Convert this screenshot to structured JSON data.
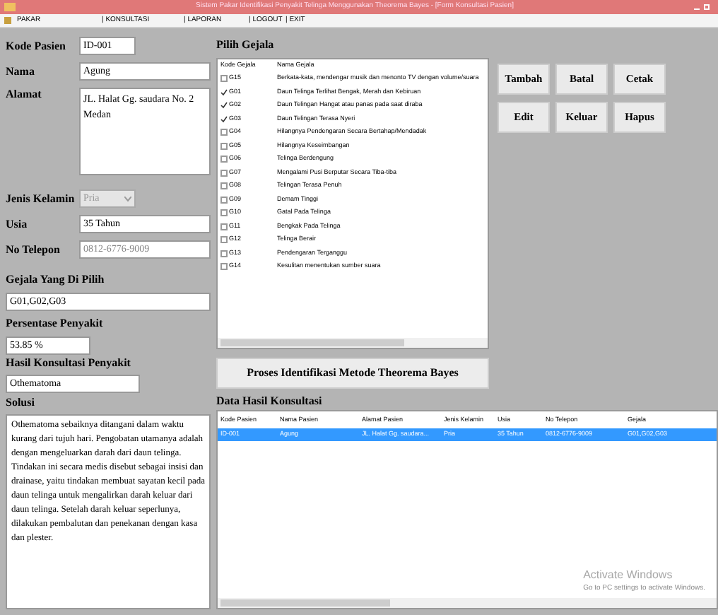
{
  "window": {
    "title": "Sistem Pakar Identifikasi Penyakit Telinga Menggunakan Theorema Bayes - [Form Konsultasi Pasien]"
  },
  "menu": [
    {
      "label": "PAKAR"
    },
    {
      "label": "| KONSULTASI"
    },
    {
      "label": "| LAPORAN"
    },
    {
      "label": "| LOGOUT"
    },
    {
      "label": "| EXIT"
    }
  ],
  "patient": {
    "fields": [
      {
        "label": "Kode Pasien",
        "value": "ID-001",
        "kind": "short"
      },
      {
        "label": "Nama",
        "value": "Agung",
        "kind": "text"
      },
      {
        "label": "Alamat",
        "value": "JL. Halat Gg. saudara No. 2 Medan",
        "kind": "area"
      },
      {
        "label": "Jenis Kelamin",
        "value": "Pria",
        "kind": "select"
      },
      {
        "label": "Usia",
        "value": "35 Tahun",
        "kind": "text"
      },
      {
        "label": "No Telepon",
        "value": "0812-6776-9009",
        "kind": "readonly"
      }
    ]
  },
  "selected_symptoms": {
    "label": "Gejala Yang Di Pilih",
    "value": "G01,G02,G03"
  },
  "percentage": {
    "label": "Persentase Penyakit",
    "value": "53.85 %"
  },
  "result": {
    "label": "Hasil Konsultasi Penyakit",
    "value": "Othematoma"
  },
  "solution": {
    "label": "Solusi",
    "text": "Othematoma sebaiknya ditangani dalam waktu kurang dari tujuh hari. Pengobatan utamanya adalah dengan mengeluarkan darah dari daun telinga. Tindakan ini secara medis disebut sebagai insisi dan drainase, yaitu tindakan membuat sayatan kecil pada daun telinga untuk mengalirkan darah keluar dari daun telinga. Setelah darah keluar seperlunya, dilakukan pembalutan dan penekanan dengan kasa dan plester."
  },
  "symptoms": {
    "title": "Pilih Gejala",
    "columns": [
      "Kode Gejala",
      "Nama Gejala"
    ],
    "rows": [
      {
        "code": "G15",
        "name": "Berkata-kata, mendengar musik dan menonto TV dengan volume/suara",
        "checked": false
      },
      {
        "code": "G01",
        "name": "Daun Telinga Terlihat Bengak, Merah dan Kebiruan",
        "checked": true
      },
      {
        "code": "G02",
        "name": "Daun Telingan Hangat atau panas pada saat diraba",
        "checked": true
      },
      {
        "code": "G03",
        "name": "Daun Telingan Terasa Nyeri",
        "checked": true
      },
      {
        "code": "G04",
        "name": "Hilangnya Pendengaran Secara Bertahap/Mendadak",
        "checked": false
      },
      {
        "code": "G05",
        "name": "Hilangnya Keseimbangan",
        "checked": false
      },
      {
        "code": "G06",
        "name": "Telinga Berdengung",
        "checked": false
      },
      {
        "code": "G07",
        "name": "Mengalami Pusi Berputar Secara Tiba-tiba",
        "checked": false
      },
      {
        "code": "G08",
        "name": "Telingan Terasa Penuh",
        "checked": false
      },
      {
        "code": "G09",
        "name": "Demam Tinggi",
        "checked": false
      },
      {
        "code": "G10",
        "name": "Gatal Pada Telinga",
        "checked": false
      },
      {
        "code": "G11",
        "name": "Bengkak Pada Telinga",
        "checked": false
      },
      {
        "code": "G12",
        "name": "Telinga Berair",
        "checked": false
      },
      {
        "code": "G13",
        "name": "Pendengaran Terganggu",
        "checked": false
      },
      {
        "code": "G14",
        "name": "Kesulitan menentukan sumber suara",
        "checked": false
      }
    ]
  },
  "buttons": [
    {
      "label": "Tambah"
    },
    {
      "label": "Batal"
    },
    {
      "label": "Cetak"
    },
    {
      "label": "Edit"
    },
    {
      "label": "Keluar"
    },
    {
      "label": "Hapus"
    }
  ],
  "process_button": {
    "label": "Proses Identifikasi Metode Theorema Bayes"
  },
  "results_table": {
    "title": "Data Hasil Konsultasi",
    "columns": [
      "Kode Pasien",
      "Nama Pasien",
      "Alamat Pasien",
      "Jenis Kelamin",
      "Usia",
      "No Telepon",
      "Gejala"
    ],
    "rows": [
      {
        "selected": true,
        "cells": [
          "ID-001",
          "Agung",
          "JL. Halat Gg. saudara...",
          "Pria",
          "35 Tahun",
          "0812-6776-9009",
          "G01,G02,G03"
        ]
      }
    ]
  },
  "os_notice": {
    "title": "Activate Windows",
    "text": "Go to PC settings to activate Windows."
  }
}
